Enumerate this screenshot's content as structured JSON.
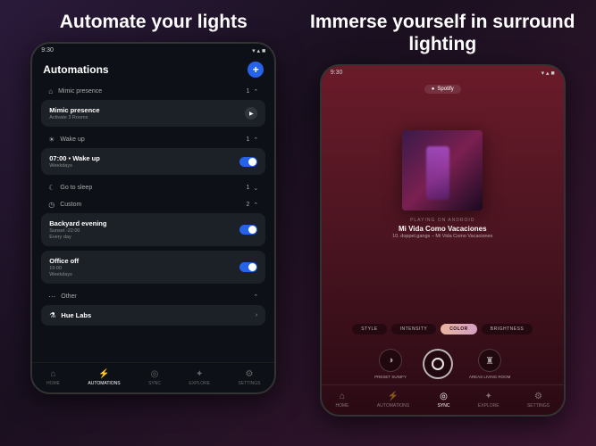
{
  "left": {
    "heading": "Automate your lights",
    "status_time": "9:30",
    "screen_title": "Automations",
    "sections": {
      "mimic": {
        "label": "Mimic presence",
        "count": "1"
      },
      "wake": {
        "label": "Wake up",
        "count": "1"
      },
      "sleep": {
        "label": "Go to sleep",
        "count": "1"
      },
      "custom": {
        "label": "Custom",
        "count": "2"
      },
      "other": {
        "label": "Other",
        "count": ""
      }
    },
    "cards": {
      "mimic": {
        "title": "Mimic presence",
        "subtitle": "Activate 3 Rooms"
      },
      "wake": {
        "title": "07:00 • Wake up",
        "subtitle": "Weekdays"
      },
      "backyard": {
        "title": "Backyard evening",
        "subtitle1": "Sunset -22:00",
        "subtitle2": "Every day"
      },
      "office": {
        "title": "Office off",
        "subtitle1": "19:00",
        "subtitle2": "Weekdays"
      },
      "labs": {
        "title": "Hue Labs"
      }
    },
    "nav": {
      "home": "HOME",
      "automations": "AUTOMATIONS",
      "sync": "SYNC",
      "explore": "EXPLORE",
      "settings": "SETTINGS"
    }
  },
  "right": {
    "heading": "Immerse yourself in surround lighting",
    "status_time": "9:30",
    "source": "Spotify",
    "playing_on": "PLAYING ON ANDROID",
    "track_title": "Mi Vida Como Vacaciones",
    "track_artist": "10. doppel.gangs – Mi Vida Como Vacaciones",
    "chips": {
      "style": "STYLE",
      "intensity": "INTENSITY",
      "color": "COLOR",
      "brightness": "BRIGHTNESS"
    },
    "round": {
      "preset": "PRESET Sunify",
      "areas": "AREAS Living room"
    },
    "nav": {
      "home": "HOME",
      "automations": "AUTOMATIONS",
      "sync": "SYNC",
      "explore": "EXPLORE",
      "settings": "SETTINGS"
    }
  }
}
